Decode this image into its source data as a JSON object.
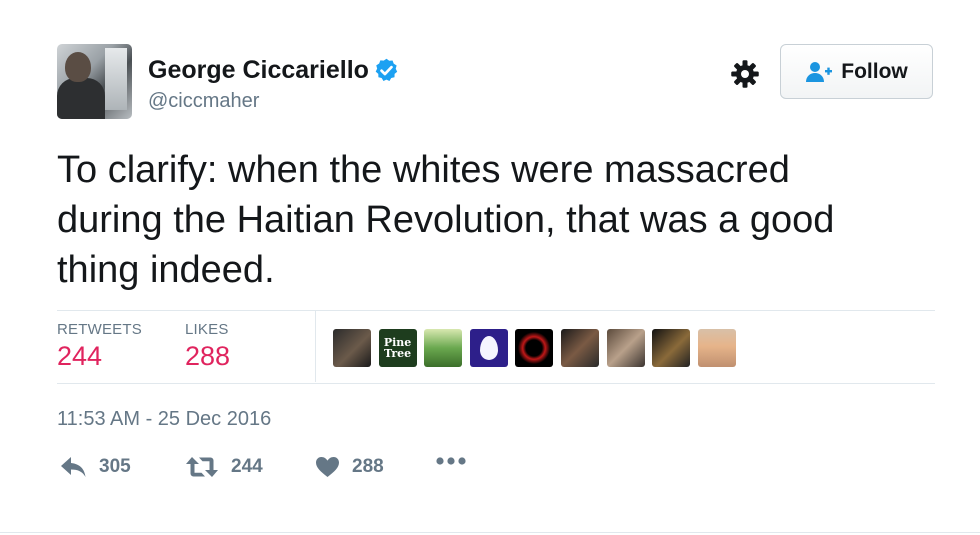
{
  "author": {
    "name": "George Ciccariello",
    "handle": "@ciccmaher",
    "verified_icon": "verified-badge-icon",
    "avatar_icon": "profile-photo"
  },
  "follow_button": {
    "label": "Follow",
    "icon": "add-user-icon"
  },
  "settings_icon": "gear-icon",
  "tweet": {
    "text": "To clarify: when the whites were massacred\nduring the Haitian Revolution, that was a good\nthing indeed."
  },
  "stats": {
    "retweets_label": "RETWEETS",
    "retweets_count": "244",
    "likes_label": "LIKES",
    "likes_count": "288"
  },
  "likers": [
    {
      "name": "liker-avatar-1"
    },
    {
      "name": "liker-avatar-2",
      "text": "Pine\nTree"
    },
    {
      "name": "liker-avatar-3"
    },
    {
      "name": "liker-avatar-4"
    },
    {
      "name": "liker-avatar-5"
    },
    {
      "name": "liker-avatar-6"
    },
    {
      "name": "liker-avatar-7"
    },
    {
      "name": "liker-avatar-8"
    },
    {
      "name": "liker-avatar-9"
    }
  ],
  "timestamp": "11:53 AM - 25 Dec 2016",
  "actions": {
    "reply_count": "305",
    "retweet_count": "244",
    "like_count": "288",
    "more_icon": "ellipsis-icon"
  },
  "colors": {
    "text": "#14171a",
    "secondary": "#657786",
    "count_red": "#e0245e",
    "verified_blue": "#1da1f2",
    "follow_icon_blue": "#1b95e0",
    "divider": "#e1e8ed"
  }
}
